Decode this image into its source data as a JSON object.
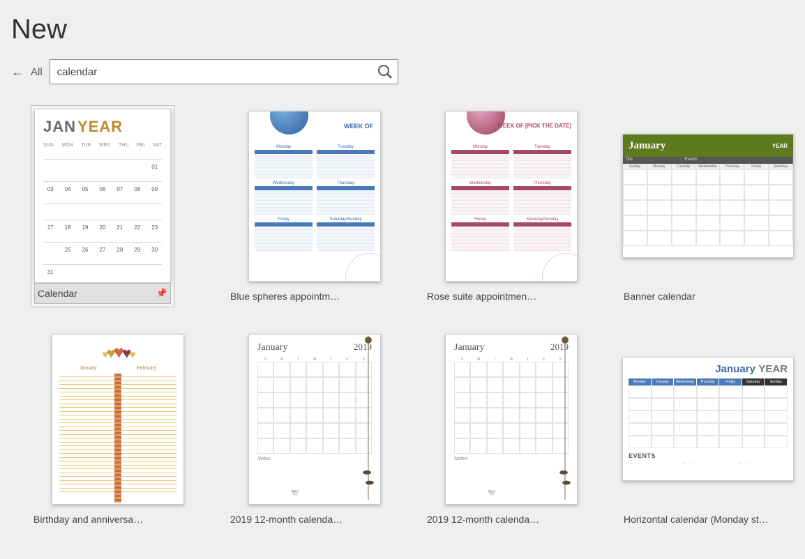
{
  "page_title": "New",
  "back_label": "All",
  "search": {
    "value": "calendar"
  },
  "templates": [
    {
      "caption": "Calendar",
      "selected": true
    },
    {
      "caption": "Blue spheres appointm…"
    },
    {
      "caption": "Rose suite appointmen…"
    },
    {
      "caption": "Banner calendar"
    },
    {
      "caption": "Birthday and anniversa…"
    },
    {
      "caption": "2019 12-month calenda…"
    },
    {
      "caption": "2019 12-month calenda…"
    },
    {
      "caption": "Horizontal calendar (Monday st…"
    }
  ],
  "t1": {
    "jan": "JAN",
    "year": "YEAR",
    "days": [
      "SUN",
      "MON",
      "TUE",
      "WED",
      "THU",
      "FRI",
      "SAT"
    ],
    "rows": [
      [
        "",
        "",
        "",
        "",
        "",
        "",
        "01"
      ],
      [
        "03",
        "04",
        "05",
        "06",
        "07",
        "08",
        "09"
      ],
      [
        "",
        "",
        "",
        "",
        "",
        "",
        ""
      ],
      [
        "17",
        "18",
        "19",
        "20",
        "21",
        "22",
        "23"
      ],
      [
        "",
        "25",
        "26",
        "27",
        "28",
        "29",
        "30"
      ],
      [
        "31",
        "",
        "",
        "",
        "",
        "",
        ""
      ]
    ]
  },
  "t2": {
    "weekof": "WEEK OF",
    "blocks": [
      "Monday",
      "Tuesday",
      "Wednesday",
      "Thursday",
      "Friday",
      "Saturday/Sunday"
    ]
  },
  "t3": {
    "weekof": "WEEK OF [PICK THE DATE]",
    "blocks": [
      "Monday",
      "Tuesday",
      "Wednesday",
      "Thursday",
      "Friday",
      "Saturday/Sunday"
    ]
  },
  "t4": {
    "month": "January",
    "year": "YEAR",
    "sub": [
      "Title",
      "Events"
    ],
    "days": [
      "Sunday",
      "Monday",
      "Tuesday",
      "Wednesday",
      "Thursday",
      "Friday",
      "Saturday"
    ]
  },
  "t5": {
    "cols": [
      "January",
      "February"
    ]
  },
  "t6": {
    "month": "January",
    "year": "2019",
    "notes": "Notes:",
    "days": [
      "S",
      "M",
      "T",
      "W",
      "T",
      "F",
      "S"
    ]
  },
  "t8": {
    "jan": "January",
    "year": "YEAR",
    "days": [
      "Monday",
      "Tuesday",
      "Wednesday",
      "Thursday",
      "Friday",
      "Saturday",
      "Sunday"
    ],
    "events": "EVENTS"
  }
}
